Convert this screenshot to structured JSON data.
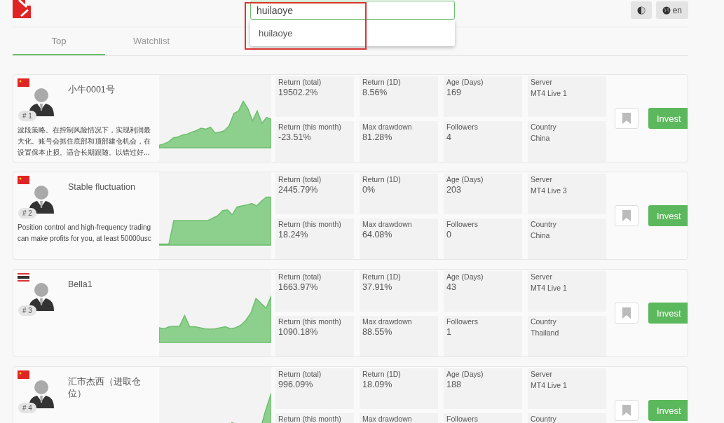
{
  "header": {
    "search": {
      "value": "huilaoye",
      "suggestions": [
        "huilaoye"
      ]
    },
    "language": "en"
  },
  "tabs": [
    {
      "label": "Top",
      "selected": true
    },
    {
      "label": "Watchlist",
      "selected": false
    }
  ],
  "traders": [
    {
      "kind": "cn",
      "name": "小牛0001号",
      "rank": "# 1",
      "description": "波段策略。在控制风险情况下，实现利润最大化。账号会抓住底部和顶部建仓机会，在设置保本止损。适合长期跟随。以错过好...",
      "stats": [
        {
          "label": "Return (total)",
          "value": "19502.2%"
        },
        {
          "label": "Return (1D)",
          "value": "8.56%"
        },
        {
          "label": "Age (Days)",
          "value": "169"
        },
        {
          "label": "Server",
          "value": "MT4 Live 1",
          "kind": "small"
        },
        {
          "label": "Return (this month)",
          "value": "-23.51%"
        },
        {
          "label": "Max drawdown",
          "value": "81.28%"
        },
        {
          "label": "Followers",
          "value": "4"
        },
        {
          "label": "Country",
          "value": "China",
          "kind": "small"
        }
      ],
      "invest": "Invest"
    },
    {
      "kind": "cn",
      "name": "Stable fluctuation",
      "rank": "# 2",
      "description": "Position control and high-frequency trading can make profits for you, at least 50000usc",
      "stats": [
        {
          "label": "Return (total)",
          "value": "2445.79%"
        },
        {
          "label": "Return (1D)",
          "value": "0%"
        },
        {
          "label": "Age (Days)",
          "value": "203"
        },
        {
          "label": "Server",
          "value": "MT4 Live 3",
          "kind": "small"
        },
        {
          "label": "Return (this month)",
          "value": "18.24%"
        },
        {
          "label": "Max drawdown",
          "value": "64.08%"
        },
        {
          "label": "Followers",
          "value": "0"
        },
        {
          "label": "Country",
          "value": "China",
          "kind": "small"
        }
      ],
      "invest": "Invest"
    },
    {
      "kind": "th",
      "name": "Bella1",
      "rank": "# 3",
      "stats": [
        {
          "label": "Return (total)",
          "value": "1663.97%"
        },
        {
          "label": "Return (1D)",
          "value": "37.91%"
        },
        {
          "label": "Age (Days)",
          "value": "43"
        },
        {
          "label": "Server",
          "value": "MT4 Live 1",
          "kind": "small"
        },
        {
          "label": "Return (this month)",
          "value": "1090.18%"
        },
        {
          "label": "Max drawdown",
          "value": "88.55%"
        },
        {
          "label": "Followers",
          "value": "1"
        },
        {
          "label": "Country",
          "value": "Thailand",
          "kind": "small"
        }
      ],
      "invest": "Invest"
    },
    {
      "kind": "cn",
      "name": "汇市杰西（进取仓位）",
      "rank": "# 4",
      "stats": [
        {
          "label": "Return (total)",
          "value": "996.09%"
        },
        {
          "label": "Return (1D)",
          "value": "18.09%"
        },
        {
          "label": "Age (Days)",
          "value": "188"
        },
        {
          "label": "Server",
          "value": "MT4 Live 1",
          "kind": "small"
        },
        {
          "label": "Return (this month)"
        },
        {
          "label": "Max drawdown"
        },
        {
          "label": "Followers"
        },
        {
          "label": "Country"
        }
      ],
      "invest": "Invest"
    }
  ]
}
